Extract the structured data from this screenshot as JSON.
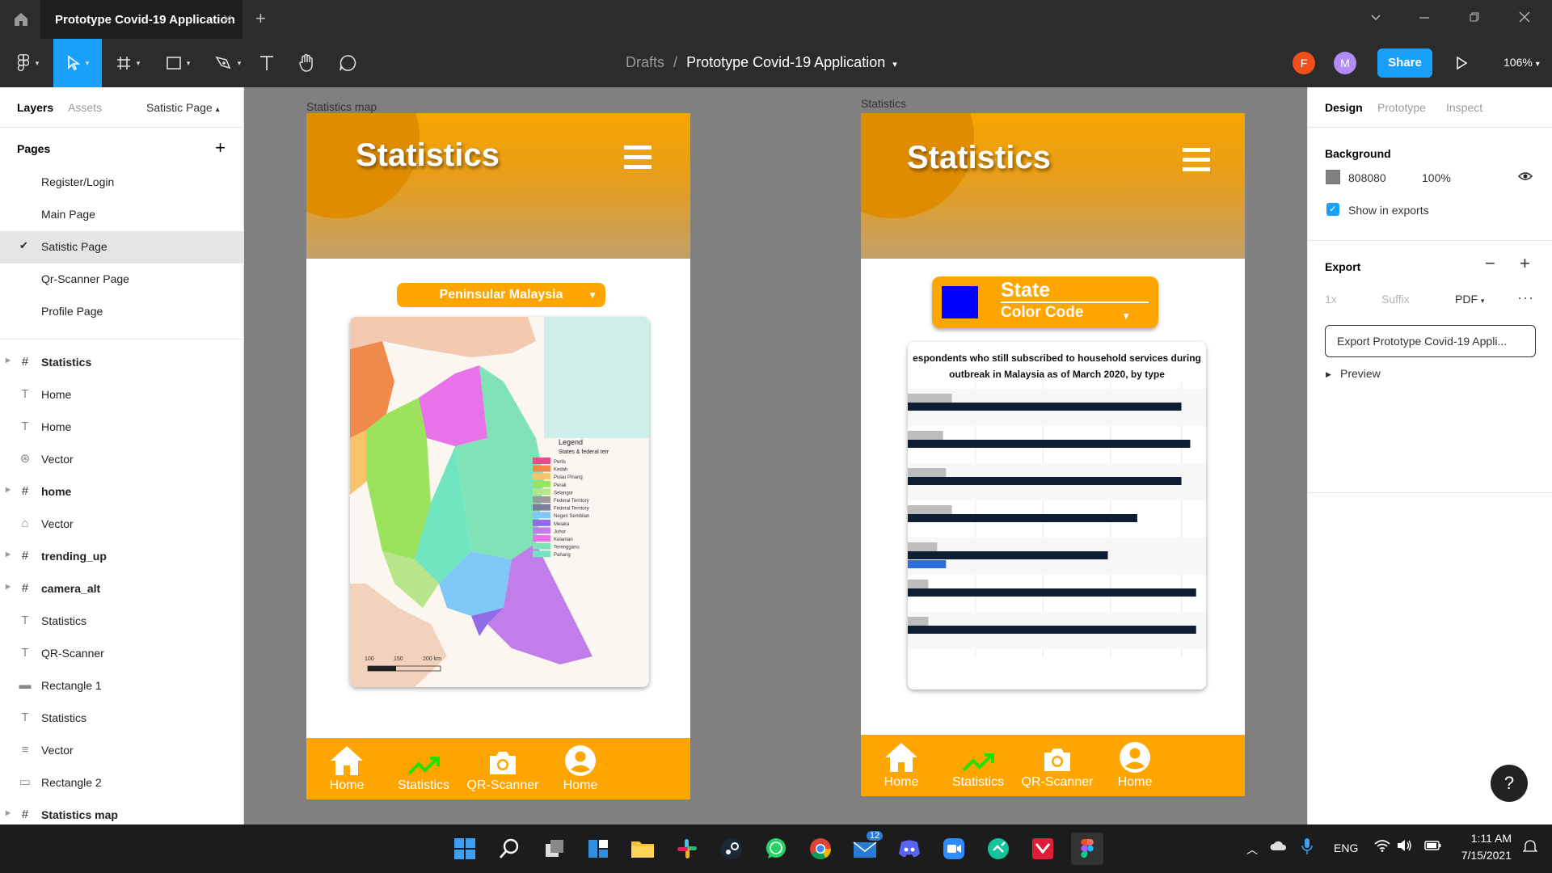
{
  "window": {
    "tab_title": "Prototype Covid-19 Application",
    "close_glyph": "✕",
    "new_tab_glyph": "+"
  },
  "toolbar": {
    "breadcrumb_drafts": "Drafts",
    "breadcrumb_sep": "/",
    "project_name": "Prototype Covid-19 Application",
    "avatar_1": "F",
    "avatar_1_color": "#f24e1e",
    "avatar_2": "M",
    "avatar_2_color": "#b18cf7",
    "share_label": "Share",
    "zoom": "106%",
    "accent": "#18a0fb"
  },
  "left_panel": {
    "tab_layers": "Layers",
    "tab_assets": "Assets",
    "current_page": "Satistic Page",
    "pages_heading": "Pages",
    "pages": [
      {
        "label": "Register/Login"
      },
      {
        "label": "Main Page"
      },
      {
        "label": "Satistic Page"
      },
      {
        "label": "Qr-Scanner Page"
      },
      {
        "label": "Profile Page"
      }
    ],
    "layers": [
      {
        "label": "Statistics",
        "icon": "frame-icon"
      },
      {
        "label": "Home",
        "icon": "text-icon"
      },
      {
        "label": "Home",
        "icon": "text-icon"
      },
      {
        "label": "Vector",
        "icon": "vector-icon"
      },
      {
        "label": "home",
        "icon": "frame-icon"
      },
      {
        "label": "Vector",
        "icon": "vector-icon"
      },
      {
        "label": "trending_up",
        "icon": "frame-icon"
      },
      {
        "label": "camera_alt",
        "icon": "frame-icon"
      },
      {
        "label": "Statistics",
        "icon": "text-icon"
      },
      {
        "label": "QR-Scanner",
        "icon": "text-icon"
      },
      {
        "label": "Rectangle 1",
        "icon": "rectangle-icon"
      },
      {
        "label": "Statistics",
        "icon": "text-icon"
      },
      {
        "label": "Vector",
        "icon": "vector-icon"
      },
      {
        "label": "Rectangle 2",
        "icon": "rectangle-icon"
      },
      {
        "label": "Statistics map",
        "icon": "frame-icon"
      }
    ]
  },
  "right_panel": {
    "tab_design": "Design",
    "tab_prototype": "Prototype",
    "tab_inspect": "Inspect",
    "background_heading": "Background",
    "background_hex": "808080",
    "background_opacity": "100%",
    "show_in_exports": "Show in exports",
    "export_heading": "Export",
    "export_scale": "1x",
    "export_suffix": "Suffix",
    "export_format": "PDF",
    "export_button": "Export Prototype Covid-19 Appli...",
    "preview": "Preview",
    "help": "?"
  },
  "canvas": {
    "background": "#808080",
    "frame_left": {
      "label": "Statistics map",
      "title": "Statistics",
      "dropdown": "Peninsular Malaysia",
      "map": {
        "legend_heading": "Legend",
        "legend_sub": "States & federal terr",
        "legend": [
          {
            "name": "Perlis",
            "color": "#e84c8f"
          },
          {
            "name": "Kedah",
            "color": "#f08a4b"
          },
          {
            "name": "Pulau Pinang",
            "color": "#f7c36b"
          },
          {
            "name": "Perak",
            "color": "#9be35c"
          },
          {
            "name": "Selangor",
            "color": "#b9e58a"
          },
          {
            "name": "Federal Territory",
            "color": "#9a9a9a"
          },
          {
            "name": "Federal Territory",
            "color": "#7d7d9e"
          },
          {
            "name": "Negeri Sembilan",
            "color": "#7ec8f5"
          },
          {
            "name": "Melaka",
            "color": "#8f6be8"
          },
          {
            "name": "Johor",
            "color": "#c27ee8"
          },
          {
            "name": "Kelantan",
            "color": "#e873e8"
          },
          {
            "name": "Terengganu",
            "color": "#7fe3b7"
          },
          {
            "name": "Pahang",
            "color": "#6fe6c0"
          }
        ],
        "scale_labels": [
          "100",
          "150",
          "200 km"
        ]
      }
    },
    "frame_right": {
      "label": "Statistics",
      "title": "Statistics",
      "state_label": "State",
      "color_code_label": "Color Code",
      "state_color": "#0000ff",
      "chart_title_1": "espondents who still subscribed to household services during",
      "chart_title_2": "outbreak in Malaysia as of March 2020, by type"
    },
    "nav": [
      {
        "label": "Home",
        "icon": "home-icon"
      },
      {
        "label": "Statistics",
        "icon": "trending-up-icon"
      },
      {
        "label": "QR-Scanner",
        "icon": "camera-icon"
      },
      {
        "label": "Home",
        "icon": "account-circle-icon"
      }
    ],
    "brand_orange": "#ffa500"
  },
  "chart_data": {
    "type": "bar",
    "title": "espondents who still subscribed to household services during outbreak in Malaysia as of March 2020, by type",
    "categories": [
      "",
      "",
      "",
      "",
      "",
      "",
      ""
    ],
    "series": [
      {
        "values": [
          15,
          12,
          13,
          15,
          10,
          7,
          7
        ],
        "color": "#bdbdbd"
      },
      {
        "values": [
          93,
          96,
          93,
          78,
          68,
          98,
          98
        ],
        "color": "#0f1f33"
      },
      {
        "values": [
          null,
          null,
          null,
          null,
          13,
          null,
          null
        ],
        "color": "#2a6fdb"
      }
    ],
    "xlim": [
      0,
      100
    ],
    "grid": true
  },
  "taskbar": {
    "apps": [
      {
        "name": "windows-start-icon"
      },
      {
        "name": "search-icon"
      },
      {
        "name": "task-view-icon"
      },
      {
        "name": "widgets-icon"
      },
      {
        "name": "file-explorer-icon"
      },
      {
        "name": "slack-icon"
      },
      {
        "name": "steam-icon"
      },
      {
        "name": "whatsapp-icon"
      },
      {
        "name": "chrome-icon"
      },
      {
        "name": "mail-icon"
      },
      {
        "name": "discord-icon"
      },
      {
        "name": "zoom-icon"
      },
      {
        "name": "grammarly-icon"
      },
      {
        "name": "mendeley-icon"
      },
      {
        "name": "figma-icon"
      }
    ],
    "mail_badge": "12",
    "language": "ENG",
    "time": "1:11 AM",
    "date": "7/15/2021"
  }
}
